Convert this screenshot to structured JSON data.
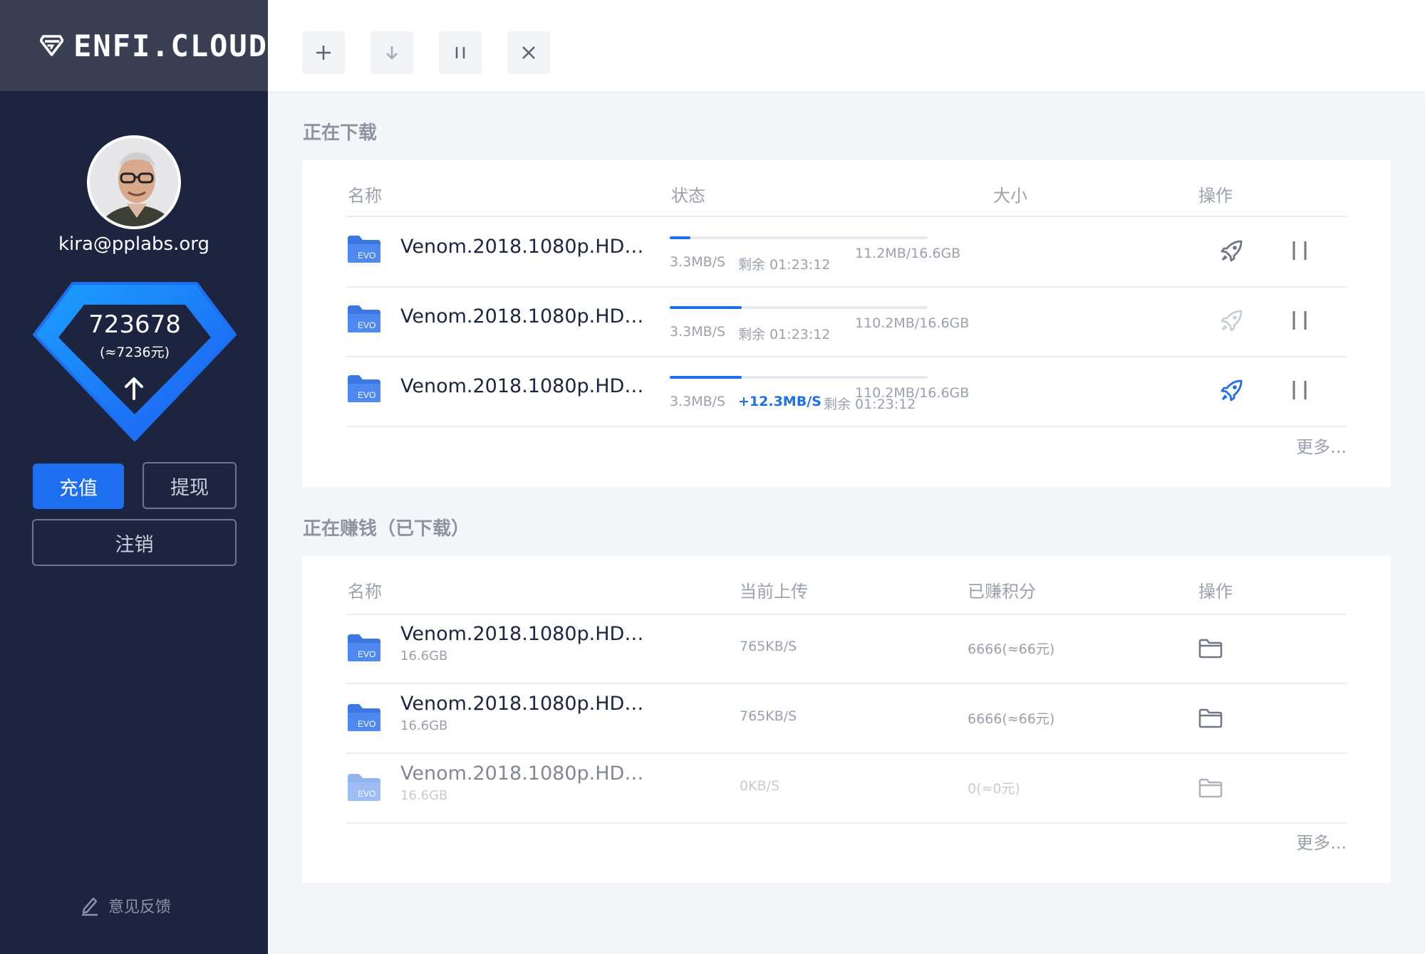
{
  "brand": {
    "name": "ENFI.CLOUD"
  },
  "user": {
    "email": "kira@pplabs.org",
    "points": "723678",
    "points_yuan": "(≈7236元)"
  },
  "sidebar": {
    "recharge_label": "充值",
    "withdraw_label": "提现",
    "logout_label": "注销",
    "feedback_label": "意见反馈"
  },
  "colors": {
    "sidebar_bg": "#1d2440",
    "brand_bg": "#3a3f54",
    "accent": "#1e6ff0",
    "page_bg": "#f4f5f9"
  },
  "toolbar": {
    "icons": [
      "plus-icon",
      "download-icon",
      "pause-icon",
      "close-icon"
    ]
  },
  "downloading": {
    "title": "正在下载",
    "headers": {
      "name": "名称",
      "status": "状态",
      "size": "大小",
      "action": "操作"
    },
    "rows": [
      {
        "badge": "EVO",
        "name": "Venom.2018.1080p.HD…",
        "progress": 0.08,
        "speed": "3.3MB/S",
        "boost": "",
        "remaining": "剩余 01:23:12",
        "size": "11.2MB/16.6GB",
        "accelerated": false,
        "accelerate_enabled": true
      },
      {
        "badge": "EVO",
        "name": "Venom.2018.1080p.HD…",
        "progress": 0.28,
        "speed": "3.3MB/S",
        "boost": "",
        "remaining": "剩余 01:23:12",
        "size": "110.2MB/16.6GB",
        "accelerated": false,
        "accelerate_enabled": false
      },
      {
        "badge": "EVO",
        "name": "Venom.2018.1080p.HD…",
        "progress": 0.28,
        "speed": "3.3MB/S",
        "boost": "+12.3MB/S",
        "remaining": "剩余 01:23:12",
        "size": "110.2MB/16.6GB",
        "accelerated": true,
        "accelerate_enabled": true
      }
    ],
    "more_label": "更多..."
  },
  "earning": {
    "title": "正在赚钱（已下载）",
    "headers": {
      "name": "名称",
      "upload": "当前上传",
      "earned": "已赚积分",
      "action": "操作"
    },
    "rows": [
      {
        "badge": "EVO",
        "name": "Venom.2018.1080p.HD…",
        "size": "16.6GB",
        "upload": "765KB/S",
        "earned": "6666(≈66元)",
        "active": true
      },
      {
        "badge": "EVO",
        "name": "Venom.2018.1080p.HD…",
        "size": "16.6GB",
        "upload": "765KB/S",
        "earned": "6666(≈66元)",
        "active": true
      },
      {
        "badge": "EVO",
        "name": "Venom.2018.1080p.HD…",
        "size": "16.6GB",
        "upload": "0KB/S",
        "earned": "0(≈0元)",
        "active": false
      }
    ],
    "more_label": "更多..."
  }
}
